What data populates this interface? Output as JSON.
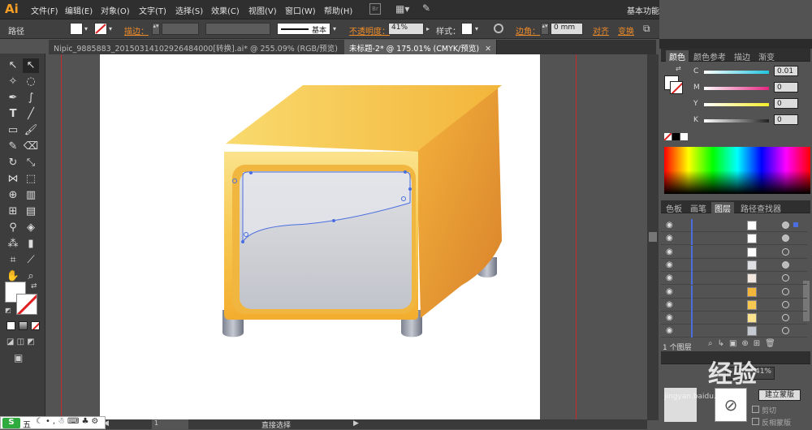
{
  "app": {
    "logo": "Ai"
  },
  "menu": [
    "文件(F)",
    "编辑(E)",
    "对象(O)",
    "文字(T)",
    "选择(S)",
    "效果(C)",
    "视图(V)",
    "窗口(W)",
    "帮助(H)"
  ],
  "menu_right": {
    "workspace": "基本功能"
  },
  "control": {
    "path_label": "路径",
    "stroke_label": "描边：",
    "stroke_style": "基本",
    "opacity_label": "不透明度：",
    "opacity_value": "41%",
    "style_label": "样式：",
    "corner_label": "边角：",
    "corner_value": "0 mm",
    "align_label": "对齐",
    "transform_label": "变换"
  },
  "tabs": [
    {
      "label": "Nipic_9885883_20150314102926484000[转换].ai* @ 255.09% (RGB/预览)",
      "active": false
    },
    {
      "label": "未标题-2* @ 175.01% (CMYK/预览)",
      "active": true
    }
  ],
  "color_panel": {
    "tabs": [
      "颜色",
      "颜色参考",
      "描边",
      "渐变"
    ],
    "channels": [
      {
        "name": "C",
        "value": "0.01",
        "track": "#21c4e0"
      },
      {
        "name": "M",
        "value": "0",
        "track": "#e5247f"
      },
      {
        "name": "Y",
        "value": "0",
        "track": "#f6ec2a"
      },
      {
        "name": "K",
        "value": "0",
        "track": "#222222"
      }
    ]
  },
  "layers_panel": {
    "tabs": [
      "色板",
      "画笔",
      "图层",
      "路径查找器"
    ],
    "footer": "1 个图层"
  },
  "bottom_panel": {
    "mask_btn": "建立蒙版",
    "clip": "剪切",
    "invert": "反相蒙版",
    "watermark": "经验",
    "watermark_sub": "jingyan.baidu.com"
  },
  "status": {
    "tool": "直接选择",
    "zoom": "1"
  },
  "tray": {
    "ime": "五"
  }
}
